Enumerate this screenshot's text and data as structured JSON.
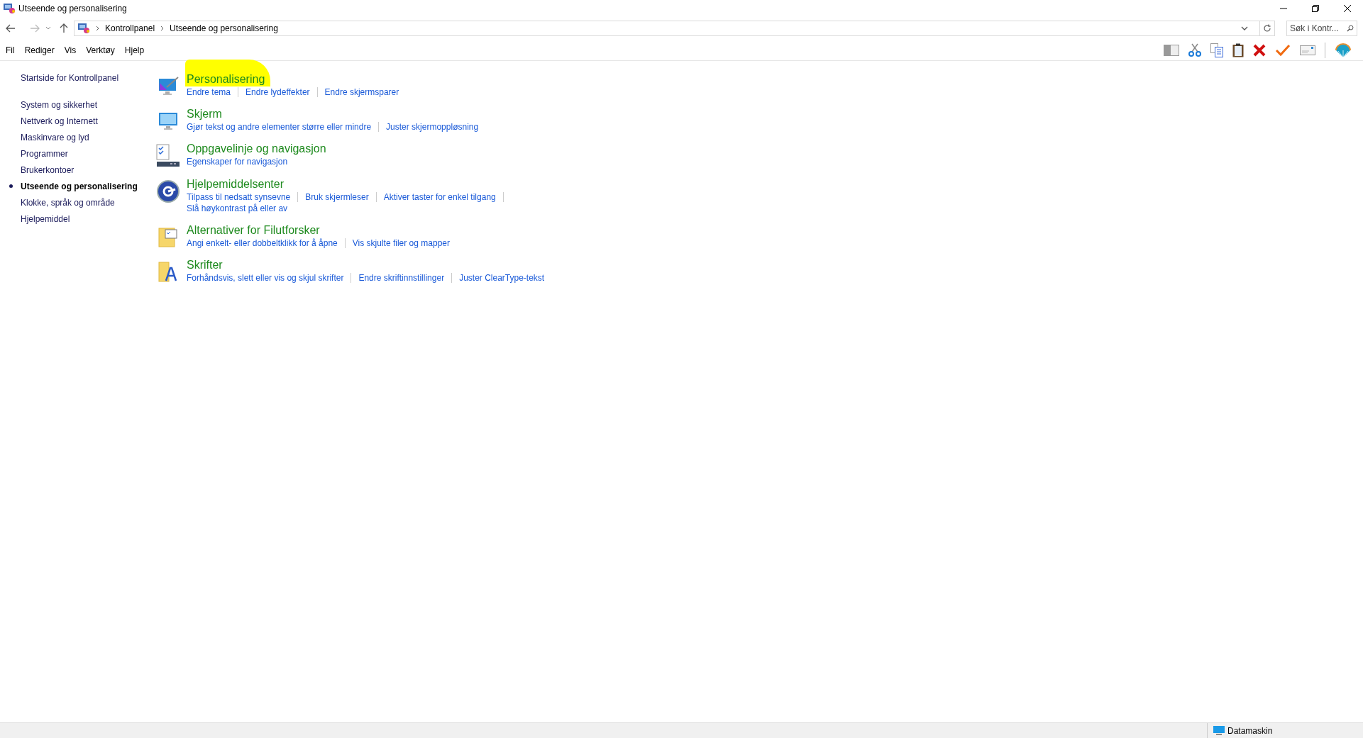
{
  "window": {
    "title": "Utseende og personalisering"
  },
  "address_bar": {
    "breadcrumbs": [
      "Kontrollpanel",
      "Utseende og personalisering"
    ]
  },
  "search": {
    "placeholder": "Søk i Kontr..."
  },
  "menu": [
    "Fil",
    "Rediger",
    "Vis",
    "Verktøy",
    "Hjelp"
  ],
  "sidebar": {
    "home": "Startside for Kontrollpanel",
    "items": [
      {
        "label": "System og sikkerhet",
        "selected": false
      },
      {
        "label": "Nettverk og Internett",
        "selected": false
      },
      {
        "label": "Maskinvare og lyd",
        "selected": false
      },
      {
        "label": "Programmer",
        "selected": false
      },
      {
        "label": "Brukerkontoer",
        "selected": false
      },
      {
        "label": "Utseende og personalisering",
        "selected": true
      },
      {
        "label": "Klokke, språk og område",
        "selected": false
      },
      {
        "label": "Hjelpemiddel",
        "selected": false
      }
    ]
  },
  "categories": [
    {
      "kind": "personalize",
      "title": "Personalisering",
      "highlighted": true,
      "links": [
        "Endre tema",
        "Endre lydeffekter",
        "Endre skjermsparer"
      ]
    },
    {
      "kind": "display",
      "title": "Skjerm",
      "highlighted": false,
      "links": [
        "Gjør tekst og andre elementer større eller mindre",
        "Juster skjermoppløsning"
      ]
    },
    {
      "kind": "taskbar",
      "title": "Oppgavelinje og navigasjon",
      "highlighted": false,
      "links": [
        "Egenskaper for navigasjon"
      ]
    },
    {
      "kind": "ease",
      "title": "Hjelpemiddelsenter",
      "highlighted": false,
      "links": [
        "Tilpass til nedsatt synsevne",
        "Bruk skjermleser",
        "Aktiver taster for enkel tilgang",
        "Slå høykontrast på eller av"
      ]
    },
    {
      "kind": "folder",
      "title": "Alternativer for Filutforsker",
      "highlighted": false,
      "links": [
        "Angi enkelt- eller dobbeltklikk for å åpne",
        "Vis skjulte filer og mapper"
      ]
    },
    {
      "kind": "fonts",
      "title": "Skrifter",
      "highlighted": false,
      "links": [
        "Forhåndsvis, slett eller vis og skjul skrifter",
        "Endre skriftinnstillinger",
        "Juster ClearType-tekst"
      ]
    }
  ],
  "status_bar": {
    "computer": "Datamaskin"
  }
}
